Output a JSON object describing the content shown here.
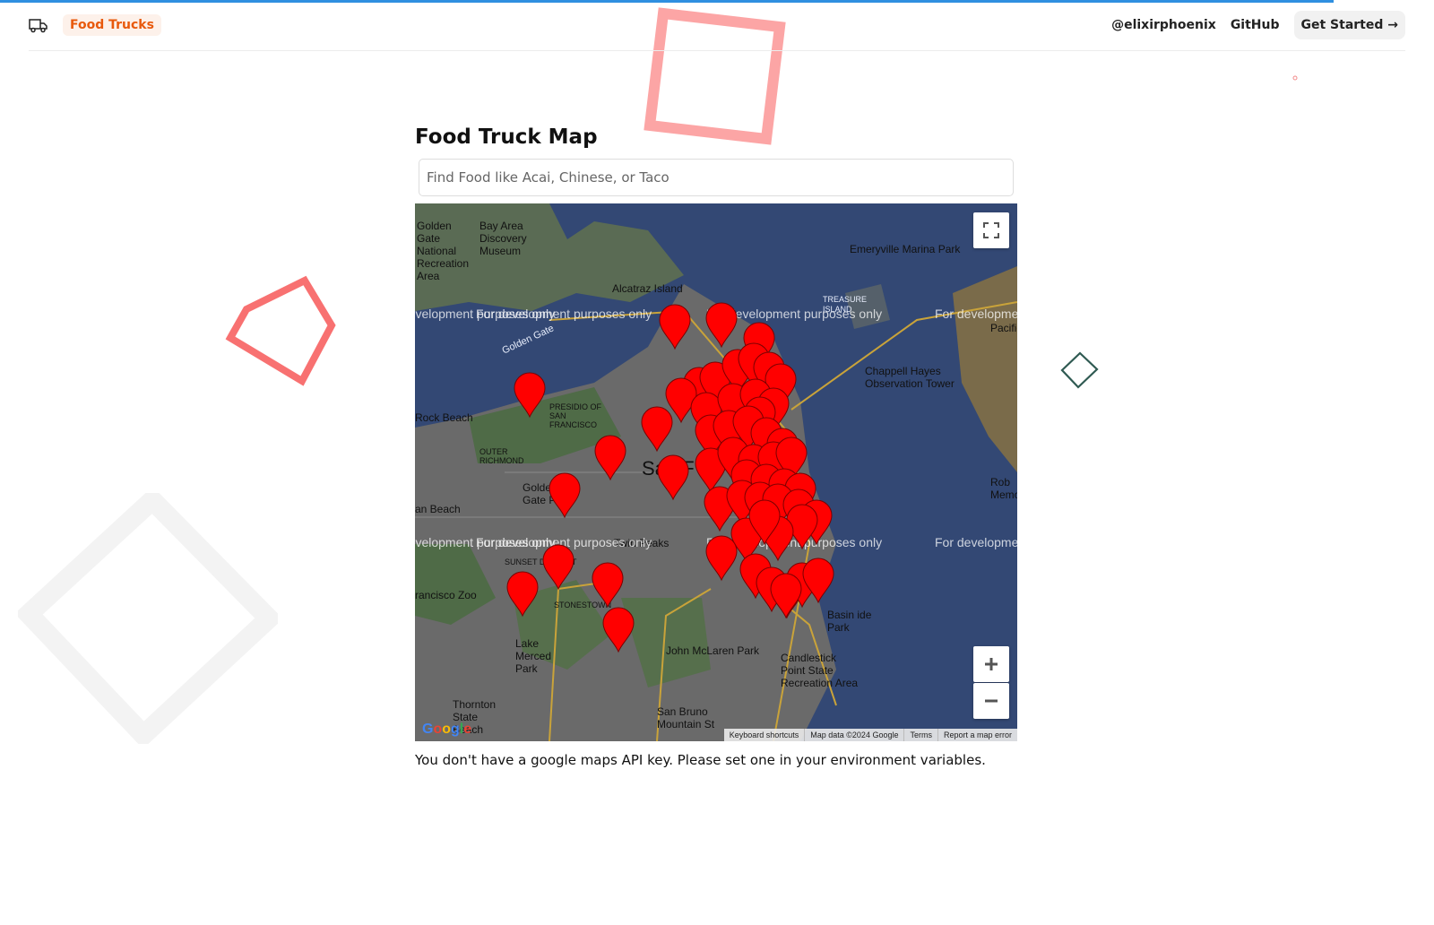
{
  "progress_percent": 93,
  "topbar": {
    "logo_icon": "truck-icon",
    "brand": "Food Trucks",
    "links": [
      "@elixirphoenix",
      "GitHub"
    ],
    "cta": "Get Started →"
  },
  "main": {
    "title": "Food Truck Map",
    "search_placeholder": "Find Food like Acai, Chinese, or Taco",
    "warning": "You don't have a google maps API key. Please set one in your environment variables."
  },
  "map": {
    "watermark": "For development purposes only",
    "city_label": "San F",
    "places": {
      "golden_gate": "Golden Gate National Recreation Area",
      "discovery": "Bay Area Discovery Museum",
      "alcatraz": "Alcatraz Island",
      "emeryville": "Emeryville Marina Park",
      "treasure": "TREASURE ISLAND",
      "chappell": "Chappell Hayes Observation Tower",
      "rock_beach": "Rock Beach",
      "presidio": "PRESIDIO OF SAN FRANCISCO",
      "outer_richmond": "OUTER RICHMOND",
      "golden_gate_park": "Golden Gate Park",
      "ocean_beach": "an Beach",
      "twin_peaks": "Twin Peaks",
      "sunset": "SUNSET DISTRICT",
      "sf_zoo": "rancisco Zoo",
      "stonestown": "STONESTOWN",
      "lake_merced": "Lake Merced Park",
      "mclaren": "John McLaren Park",
      "candlestick": "Candlestick Point State Recreation Area",
      "basin": "Basin ide Park",
      "thornton": "Thornton State Beach",
      "san_bruno": "San Bruno Mountain St",
      "rob": "Rob Memoria",
      "pacific": "Pacific",
      "golden_gate_water": "Golden Gate"
    },
    "controls": {
      "fullscreen_icon": "fullscreen-icon",
      "zoom_in_icon": "plus-icon",
      "zoom_out_icon": "minus-icon"
    },
    "attribution": [
      "Keyboard shortcuts",
      "Map data ©2024 Google",
      "Terms",
      "Report a map error"
    ],
    "google_logo": "Google",
    "marker_color": "#ff0000"
  }
}
